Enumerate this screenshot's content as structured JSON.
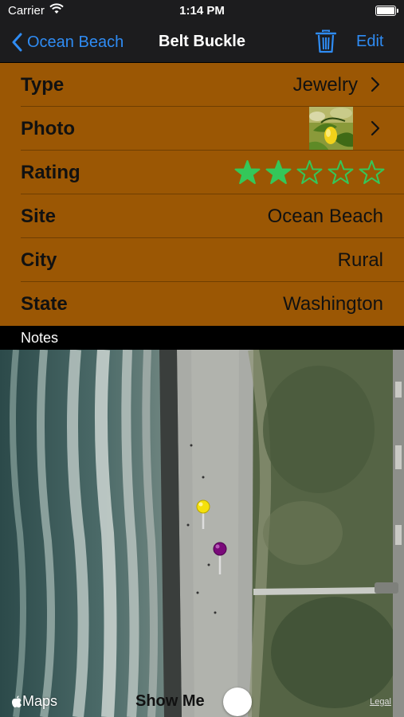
{
  "status_bar": {
    "carrier": "Carrier",
    "time": "1:14 PM"
  },
  "nav": {
    "back_label": "Ocean Beach",
    "title": "Belt Buckle",
    "edit_label": "Edit"
  },
  "details": {
    "type": {
      "label": "Type",
      "value": "Jewelry"
    },
    "photo": {
      "label": "Photo"
    },
    "rating": {
      "label": "Rating",
      "value": 2,
      "max": 5
    },
    "site": {
      "label": "Site",
      "value": "Ocean Beach"
    },
    "city": {
      "label": "City",
      "value": "Rural"
    },
    "state": {
      "label": "State",
      "value": "Washington"
    }
  },
  "notes": {
    "label": "Notes"
  },
  "map": {
    "attribution": "Maps",
    "legal_label": "Legal",
    "show_me_label": "Show Me",
    "pins": [
      {
        "name": "yellow-pin",
        "color": "#f5e10c"
      },
      {
        "name": "purple-pin",
        "color": "#7a0a7a"
      }
    ]
  },
  "colors": {
    "accent": "#2f8cf4",
    "table_bg": "#9b5704",
    "star": "#34c759"
  }
}
